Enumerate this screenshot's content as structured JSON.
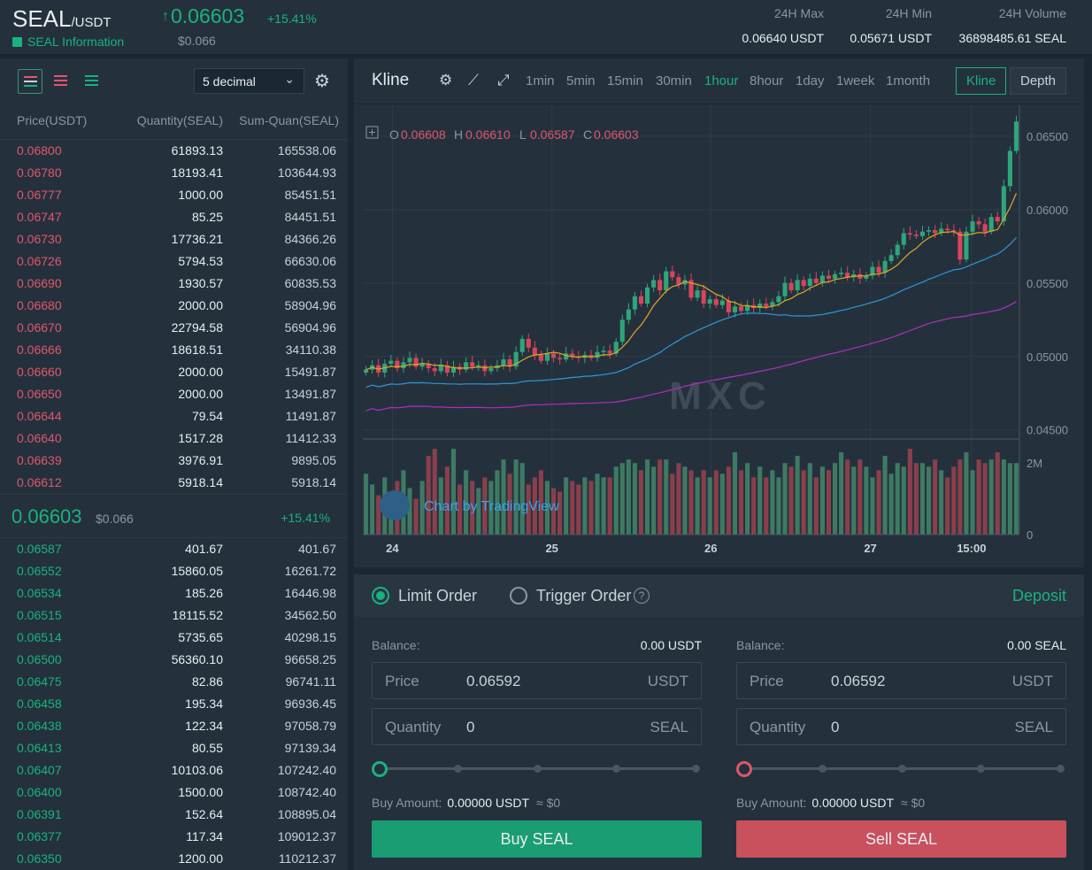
{
  "header": {
    "pair_base": "SEAL",
    "pair_quote": "/USDT",
    "info_link": "SEAL Information",
    "arrow": "↑",
    "last_price": "0.06603",
    "change_pct": "+15.41%",
    "last_usd": "$0.066",
    "stats": [
      {
        "label": "24H Max",
        "value": "0.06640 USDT"
      },
      {
        "label": "24H Min",
        "value": "0.05671 USDT"
      },
      {
        "label": "24H Volume",
        "value": "36898485.61 SEAL"
      }
    ]
  },
  "orderbook": {
    "decimal": "5 decimal",
    "cols": {
      "price": "Price(USDT)",
      "qty": "Quantity(SEAL)",
      "sum": "Sum-Quan(SEAL)"
    },
    "asks": [
      [
        "0.06800",
        "61893.13",
        "165538.06"
      ],
      [
        "0.06780",
        "18193.41",
        "103644.93"
      ],
      [
        "0.06777",
        "1000.00",
        "85451.51"
      ],
      [
        "0.06747",
        "85.25",
        "84451.51"
      ],
      [
        "0.06730",
        "17736.21",
        "84366.26"
      ],
      [
        "0.06726",
        "5794.53",
        "66630.06"
      ],
      [
        "0.06690",
        "1930.57",
        "60835.53"
      ],
      [
        "0.06680",
        "2000.00",
        "58904.96"
      ],
      [
        "0.06670",
        "22794.58",
        "56904.96"
      ],
      [
        "0.06666",
        "18618.51",
        "34110.38"
      ],
      [
        "0.06660",
        "2000.00",
        "15491.87"
      ],
      [
        "0.06650",
        "2000.00",
        "13491.87"
      ],
      [
        "0.06644",
        "79.54",
        "11491.87"
      ],
      [
        "0.06640",
        "1517.28",
        "11412.33"
      ],
      [
        "0.06639",
        "3976.91",
        "9895.05"
      ],
      [
        "0.06612",
        "5918.14",
        "5918.14"
      ]
    ],
    "mid": {
      "price": "0.06603",
      "usd": "$0.066",
      "change": "+15.41%"
    },
    "bids": [
      [
        "0.06587",
        "401.67",
        "401.67"
      ],
      [
        "0.06552",
        "15860.05",
        "16261.72"
      ],
      [
        "0.06534",
        "185.26",
        "16446.98"
      ],
      [
        "0.06515",
        "18115.52",
        "34562.50"
      ],
      [
        "0.06514",
        "5735.65",
        "40298.15"
      ],
      [
        "0.06500",
        "56360.10",
        "96658.25"
      ],
      [
        "0.06475",
        "82.86",
        "96741.11"
      ],
      [
        "0.06458",
        "195.34",
        "96936.45"
      ],
      [
        "0.06438",
        "122.34",
        "97058.79"
      ],
      [
        "0.06413",
        "80.55",
        "97139.34"
      ],
      [
        "0.06407",
        "10103.06",
        "107242.40"
      ],
      [
        "0.06400",
        "1500.00",
        "108742.40"
      ],
      [
        "0.06391",
        "152.64",
        "108895.04"
      ],
      [
        "0.06377",
        "117.34",
        "109012.37"
      ],
      [
        "0.06350",
        "1200.00",
        "110212.37"
      ]
    ]
  },
  "chart": {
    "title": "Kline",
    "intervals": [
      "1min",
      "5min",
      "15min",
      "30min",
      "1hour",
      "8hour",
      "1day",
      "1week",
      "1month"
    ],
    "active_interval": "1hour",
    "view_kline": "Kline",
    "view_depth": "Depth",
    "ohlc": {
      "o_label": "O",
      "o": "0.06608",
      "h_label": "H",
      "h": "0.06610",
      "l_label": "L",
      "l": "0.06587",
      "c_label": "C",
      "c": "0.06603"
    },
    "watermark": "MXC",
    "credit": "Chart by TradingView",
    "colors": {
      "up": "#2fa57a",
      "down": "#d9455b",
      "ma_fast": "#e0a726",
      "ma_mid": "#2f97d8",
      "ma_slow": "#b02fbb"
    }
  },
  "chart_data": {
    "type": "candlestick",
    "price_axis": {
      "labels": [
        "0.06500",
        "0.06000",
        "0.05500",
        "0.05000",
        "0.04500"
      ],
      "values": [
        0.065,
        0.06,
        0.055,
        0.05,
        0.045
      ],
      "ylim": [
        0.0445,
        0.0665
      ]
    },
    "volume_axis": {
      "labels": [
        "2M",
        "0"
      ],
      "values": [
        2000000,
        0
      ],
      "ylim": [
        0,
        2600000
      ]
    },
    "x_ticks": [
      "24",
      "25",
      "26",
      "27",
      "15:00"
    ],
    "close": [
      0.0491,
      0.0494,
      0.0489,
      0.0495,
      0.0497,
      0.0492,
      0.0496,
      0.0499,
      0.0493,
      0.0495,
      0.0492,
      0.049,
      0.0494,
      0.0489,
      0.0493,
      0.0491,
      0.0496,
      0.0493,
      0.0494,
      0.049,
      0.0492,
      0.0494,
      0.0498,
      0.0493,
      0.0503,
      0.0512,
      0.0506,
      0.0501,
      0.0497,
      0.0502,
      0.0499,
      0.0498,
      0.0502,
      0.05,
      0.0499,
      0.0501,
      0.0499,
      0.0503,
      0.0504,
      0.0502,
      0.051,
      0.0525,
      0.0532,
      0.0541,
      0.0536,
      0.0547,
      0.0552,
      0.0545,
      0.0558,
      0.0554,
      0.0549,
      0.0552,
      0.054,
      0.0545,
      0.0536,
      0.0539,
      0.0535,
      0.0538,
      0.053,
      0.0534,
      0.0531,
      0.0535,
      0.0533,
      0.0536,
      0.0534,
      0.0537,
      0.0541,
      0.055,
      0.0545,
      0.0552,
      0.0548,
      0.0553,
      0.055,
      0.0555,
      0.0553,
      0.0556,
      0.0557,
      0.0554,
      0.0556,
      0.0553,
      0.0555,
      0.0561,
      0.0557,
      0.0565,
      0.0569,
      0.0576,
      0.0584,
      0.0583,
      0.0582,
      0.0585,
      0.0586,
      0.0584,
      0.0587,
      0.0586,
      0.0585,
      0.0566,
      0.0585,
      0.0592,
      0.059,
      0.0585,
      0.0595,
      0.0592,
      0.0616,
      0.064,
      0.066
    ],
    "volume": [
      1.7,
      1.4,
      1.1,
      1.6,
      1.2,
      1.5,
      1.8,
      1.3,
      1.0,
      1.5,
      2.2,
      2.4,
      1.6,
      1.9,
      2.4,
      1.4,
      1.8,
      1.5,
      1.3,
      1.6,
      1.5,
      1.8,
      2.1,
      1.7,
      2.1,
      2.0,
      1.4,
      1.6,
      1.8,
      1.5,
      1.3,
      1.2,
      1.6,
      1.5,
      1.4,
      1.6,
      1.5,
      1.7,
      1.6,
      1.6,
      1.9,
      2.0,
      2.1,
      2.0,
      1.8,
      2.1,
      1.9,
      2.1,
      2.1,
      1.7,
      2.0,
      1.9,
      1.8,
      1.6,
      1.8,
      1.6,
      1.8,
      1.7,
      1.9,
      2.3,
      1.8,
      2.0,
      1.6,
      1.9,
      1.6,
      1.8,
      1.6,
      2.0,
      1.9,
      2.2,
      1.8,
      2.0,
      1.6,
      1.9,
      1.8,
      2.0,
      2.3,
      2.1,
      1.9,
      2.1,
      1.9,
      1.6,
      1.8,
      2.2,
      1.7,
      2.0,
      1.9,
      2.4,
      2.0,
      2.0,
      1.9,
      2.1,
      1.8,
      1.6,
      1.9,
      2.1,
      2.3,
      1.8,
      2.1,
      2.0,
      2.1,
      2.3,
      2.1,
      2.0,
      2.0
    ]
  },
  "form": {
    "limit_label": "Limit Order",
    "trigger_label": "Trigger Order",
    "help": "?",
    "deposit": "Deposit",
    "buy": {
      "balance_label": "Balance:",
      "balance": "0.00 USDT",
      "price_label": "Price",
      "price": "0.06592",
      "price_unit": "USDT",
      "qty_label": "Quantity",
      "qty": "0",
      "qty_unit": "SEAL",
      "amount_label": "Buy Amount:",
      "amount": "0.00000 USDT",
      "approx": "≈ $0",
      "button": "Buy SEAL",
      "color": "#1a9d73"
    },
    "sell": {
      "balance_label": "Balance:",
      "balance": "0.00 SEAL",
      "price_label": "Price",
      "price": "0.06592",
      "price_unit": "USDT",
      "qty_label": "Quantity",
      "qty": "0",
      "qty_unit": "SEAL",
      "amount_label": "Buy Amount:",
      "amount": "0.00000 USDT",
      "approx": "≈ $0",
      "button": "Sell SEAL",
      "color": "#c9505d"
    }
  }
}
